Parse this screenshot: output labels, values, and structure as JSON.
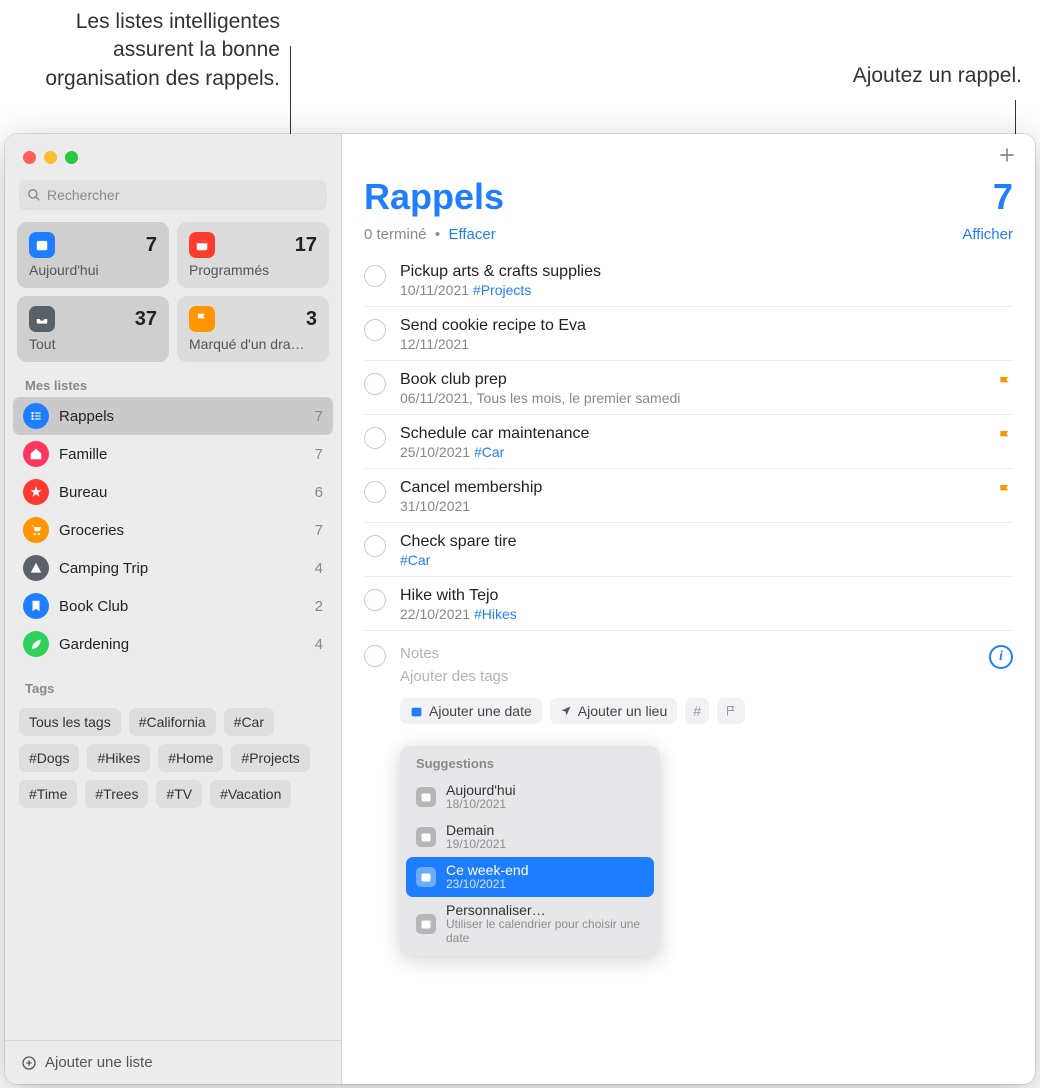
{
  "annotations": {
    "smart": "Les listes intelligentes\nassurent la bonne\norganisation des rappels.",
    "add": "Ajoutez un rappel."
  },
  "search": {
    "placeholder": "Rechercher"
  },
  "smart": {
    "today": {
      "label": "Aujourd'hui",
      "count": "7",
      "color": "#1f7eff"
    },
    "scheduled": {
      "label": "Programmés",
      "count": "17",
      "color": "#ff3b30"
    },
    "all": {
      "label": "Tout",
      "count": "37",
      "color": "#5b6169"
    },
    "flagged": {
      "label": "Marqué d'un dra…",
      "count": "3",
      "color": "#ff9500"
    }
  },
  "mylists_header": "Mes listes",
  "lists": [
    {
      "name": "Rappels",
      "count": "7",
      "color": "#1f7eff",
      "icon": "list",
      "selected": true
    },
    {
      "name": "Famille",
      "count": "7",
      "color": "#ff375f",
      "icon": "house"
    },
    {
      "name": "Bureau",
      "count": "6",
      "color": "#ff3b30",
      "icon": "star"
    },
    {
      "name": "Groceries",
      "count": "7",
      "color": "#ff9500",
      "icon": "cart"
    },
    {
      "name": "Camping Trip",
      "count": "4",
      "color": "#5b6169",
      "icon": "tent"
    },
    {
      "name": "Book Club",
      "count": "2",
      "color": "#1f7eff",
      "icon": "bookmark"
    },
    {
      "name": "Gardening",
      "count": "4",
      "color": "#30d158",
      "icon": "leaf"
    }
  ],
  "tags_header": "Tags",
  "tags": [
    "Tous les tags",
    "#California",
    "#Car",
    "#Dogs",
    "#Hikes",
    "#Home",
    "#Projects",
    "#Time",
    "#Trees",
    "#TV",
    "#Vacation"
  ],
  "addlist": "Ajouter une liste",
  "main": {
    "title": "Rappels",
    "count": "7",
    "completed": "0 terminé",
    "clear": "Effacer",
    "show": "Afficher"
  },
  "reminders": [
    {
      "title": "Pickup arts & crafts supplies",
      "meta": "10/11/2021",
      "tag": "#Projects",
      "flag": false
    },
    {
      "title": "Send cookie recipe to Eva",
      "meta": "12/11/2021",
      "flag": false
    },
    {
      "title": "Book club prep",
      "meta": "06/11/2021, Tous les mois, le premier samedi",
      "flag": true
    },
    {
      "title": "Schedule car maintenance",
      "meta": "25/10/2021",
      "tag": "#Car",
      "flag": true
    },
    {
      "title": "Cancel membership",
      "meta": "31/10/2021",
      "flag": true
    },
    {
      "title": "Check spare tire",
      "meta": "",
      "tag": "#Car",
      "flag": false
    },
    {
      "title": "Hike with Tejo",
      "meta": "22/10/2021",
      "tag": "#Hikes",
      "flag": false
    }
  ],
  "new": {
    "notes": "Notes",
    "addtags": "Ajouter des tags",
    "adddate": "Ajouter une date",
    "addloc": "Ajouter un lieu",
    "hash": "#"
  },
  "suggestions": {
    "header": "Suggestions",
    "items": [
      {
        "t1": "Aujourd'hui",
        "t2": "18/10/2021",
        "selected": false
      },
      {
        "t1": "Demain",
        "t2": "19/10/2021",
        "selected": false
      },
      {
        "t1": "Ce week-end",
        "t2": "23/10/2021",
        "selected": true
      },
      {
        "t1": "Personnaliser…",
        "t2": "Utiliser le calendrier pour choisir une date",
        "selected": false
      }
    ]
  }
}
